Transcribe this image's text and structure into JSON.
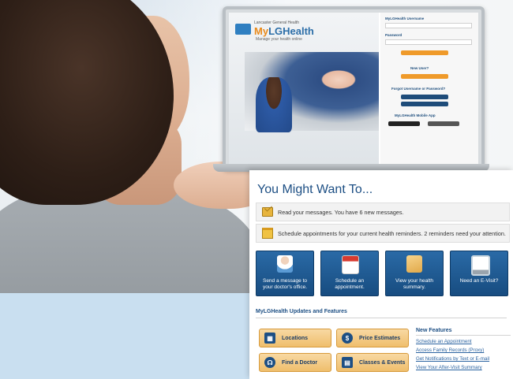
{
  "laptop_screen": {
    "org": "Lancaster General Health",
    "brand_my": "My",
    "brand_lg": "LGHealth",
    "tagline": "Manage your health online",
    "login": {
      "username_label": "MyLGHealth Username",
      "password_label": "Password",
      "sign_in": "Sign In"
    },
    "new_user_label": "New User?",
    "sign_up": "Sign Up Now",
    "forgot_label": "Forgot Username or Password?",
    "forgot_username": "Forgot Username",
    "forgot_password": "Forgot Password",
    "mobile_label": "MyLGHealth Mobile App"
  },
  "panel": {
    "title": "You Might Want To...",
    "notices": [
      {
        "icon": "envelope-icon",
        "text": "Read your messages. You have 6 new messages."
      },
      {
        "icon": "calendar-icon",
        "text": "Schedule appointments for your current health reminders. 2 reminders need your attention."
      }
    ],
    "actions": [
      {
        "icon": "doctor-icon",
        "label_1": "Send a message to",
        "label_2": "your doctor's office."
      },
      {
        "icon": "calendar-icon",
        "label_1": "Schedule an",
        "label_2": "appointment."
      },
      {
        "icon": "folder-icon",
        "label_1": "View your health",
        "label_2": "summary."
      },
      {
        "icon": "computer-icon",
        "label_1": "Need an E-Visit?",
        "label_2": ""
      }
    ],
    "updates_title": "MyLGHealth Updates and Features",
    "features": [
      {
        "icon": "building-icon",
        "glyph": "▦",
        "label": "Locations"
      },
      {
        "icon": "dollar-icon",
        "glyph": "$",
        "label": "Price Estimates"
      },
      {
        "icon": "stethoscope-icon",
        "glyph": "☊",
        "label": "Find a Doctor"
      },
      {
        "icon": "classes-icon",
        "glyph": "▤",
        "label": "Classes & Events"
      }
    ],
    "new_features": {
      "title": "New Features",
      "links": [
        "Schedule an Appointment",
        "Access Family Records (Proxy)",
        "Get Notifications by Text or E-mail",
        "View Your After-Visit Summary"
      ]
    }
  }
}
